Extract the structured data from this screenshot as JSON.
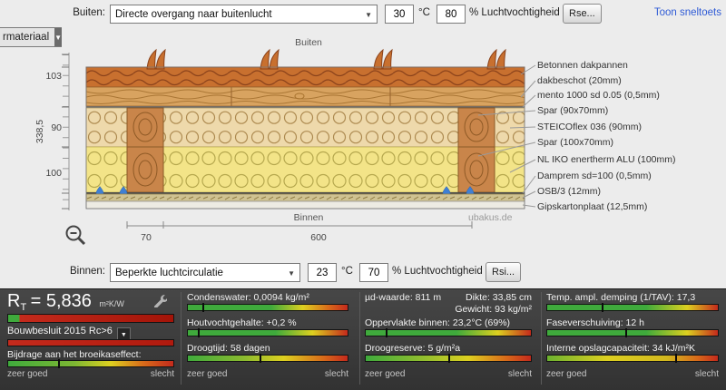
{
  "top_bar": {
    "label": "Buiten:",
    "dropdown": "Directe overgang naar buitenlucht",
    "temp": "30",
    "deg": "°C",
    "humidity": "80",
    "humidity_label": "% Luchtvochtigheid",
    "surface_btn": "Rse...",
    "shortcut_link": "Toon sneltoets"
  },
  "material_dropdown": {
    "label": "rmateriaal"
  },
  "diagram": {
    "outside": "Buiten",
    "inside": "Binnen",
    "watermark": "ubakus.de",
    "dims": {
      "total_height": "338,5",
      "top": "103",
      "mid": "90",
      "bottom": "100",
      "beam_width": "70",
      "spacing": "600"
    },
    "layers": [
      "Betonnen dakpannen",
      "dakbeschot (20mm)",
      "mento 1000 sd 0.05 (0,5mm)",
      "Spar (90x70mm)",
      "STEICOflex 036 (90mm)",
      "Spar (100x70mm)",
      "NL IKO enertherm ALU (100mm)",
      "Damprem sd=100 (0,5mm)",
      "OSB/3 (12mm)",
      "Gipskartonplaat (12,5mm)"
    ]
  },
  "bottom_bar": {
    "label": "Binnen:",
    "dropdown": "Beperkte luchtcirculatie",
    "temp": "23",
    "deg": "°C",
    "humidity": "70",
    "humidity_label": "% Luchtvochtigheid",
    "surface_btn": "Rsi..."
  },
  "results": {
    "rt_r": "R",
    "rt_sub": "T",
    "rt_eq": "= 5,836",
    "rt_unit": "m²K/W",
    "bouwbesluit": "Bouwbesluit 2015 Rc>6",
    "greenhouse_label": "Bijdrage aan het broeikaseffect:",
    "condenswater": "Condenswater: 0,0094 kg/m²",
    "houtvocht": "Houtvochtgehalte: +0,2 %",
    "droogtijd": "Droogtijd: 58 dagen",
    "ud": "µd-waarde: 811 m",
    "dikte": "Dikte: 33,85 cm",
    "gewicht": "Gewicht: 93 kg/m²",
    "oppervlakte": "Oppervlakte binnen: 23,2°C (69%)",
    "droogreserve": "Droogreserve: 5 g/m²a",
    "temp_ampl": "Temp. ampl. demping (1/TAV): 17,3",
    "fase": "Faseverschuiving: 12 h",
    "opslag": "Interne opslagcapaciteit: 34 kJ/m²K",
    "good": "zeer goed",
    "bad": "slecht"
  },
  "colors": {
    "good_green": "#3faa3c",
    "warn_yellow": "#ddd020",
    "bad_red": "#c42a1c",
    "tile_orange": "#c8702f",
    "link_blue": "#2f5bd6"
  },
  "bars": {
    "rt": {
      "css": "linear-gradient(90deg,#3faa3c 0%,#3faa3c 7%,#c42a1c 7%,#a31408 100%)",
      "marker": null
    },
    "bouwbesluit": {
      "css": "linear-gradient(90deg,#c42a1c 0%,#b01a0e 100%)",
      "marker": null
    },
    "greenhouse": {
      "css": "linear-gradient(90deg,#3faa3c 0%,#7db733 40%,#ddd020 62%,#d86a1a 82%,#c42a1c 100%)",
      "marker": 0.3
    },
    "condens": {
      "css": "linear-gradient(90deg,#3faa3c 0%,#3faa3c 52%,#ddd020 72%,#d86a1a 88%,#c42a1c 100%)",
      "marker": 0.09
    },
    "houtvocht": {
      "css": "linear-gradient(90deg,#3faa3c 0%,#3faa3c 55%,#ddd020 78%,#c42a1c 100%)",
      "marker": 0.06
    },
    "droogtijd": {
      "css": "linear-gradient(90deg,#3faa3c 0%,#8bbb2f 35%,#ddd020 60%,#d86a1a 85%,#c42a1c 100%)",
      "marker": 0.45
    },
    "oppervlakte": {
      "css": "linear-gradient(90deg,#3faa3c 0%,#3faa3c 55%,#ddd020 80%,#c42a1c 100%)",
      "marker": 0.12
    },
    "droogreserve": {
      "css": "linear-gradient(90deg,#3faa3c 0%,#9ec22c 40%,#ddd020 62%,#d86a1a 85%,#c42a1c 100%)",
      "marker": 0.5
    },
    "tempampl": {
      "css": "linear-gradient(90deg,#3faa3c 0%,#3faa3c 58%,#ddd020 82%,#c42a1c 100%)",
      "marker": 0.32
    },
    "fase": {
      "css": "linear-gradient(90deg,#3faa3c 0%,#3faa3c 58%,#ddd020 82%,#c42a1c 100%)",
      "marker": 0.46
    },
    "opslag": {
      "css": "linear-gradient(90deg,#6cb22f 0%,#ddd020 35%,#d2b81e 70%,#d86a1a 88%,#c42a1c 100%)",
      "marker": 0.75
    }
  }
}
